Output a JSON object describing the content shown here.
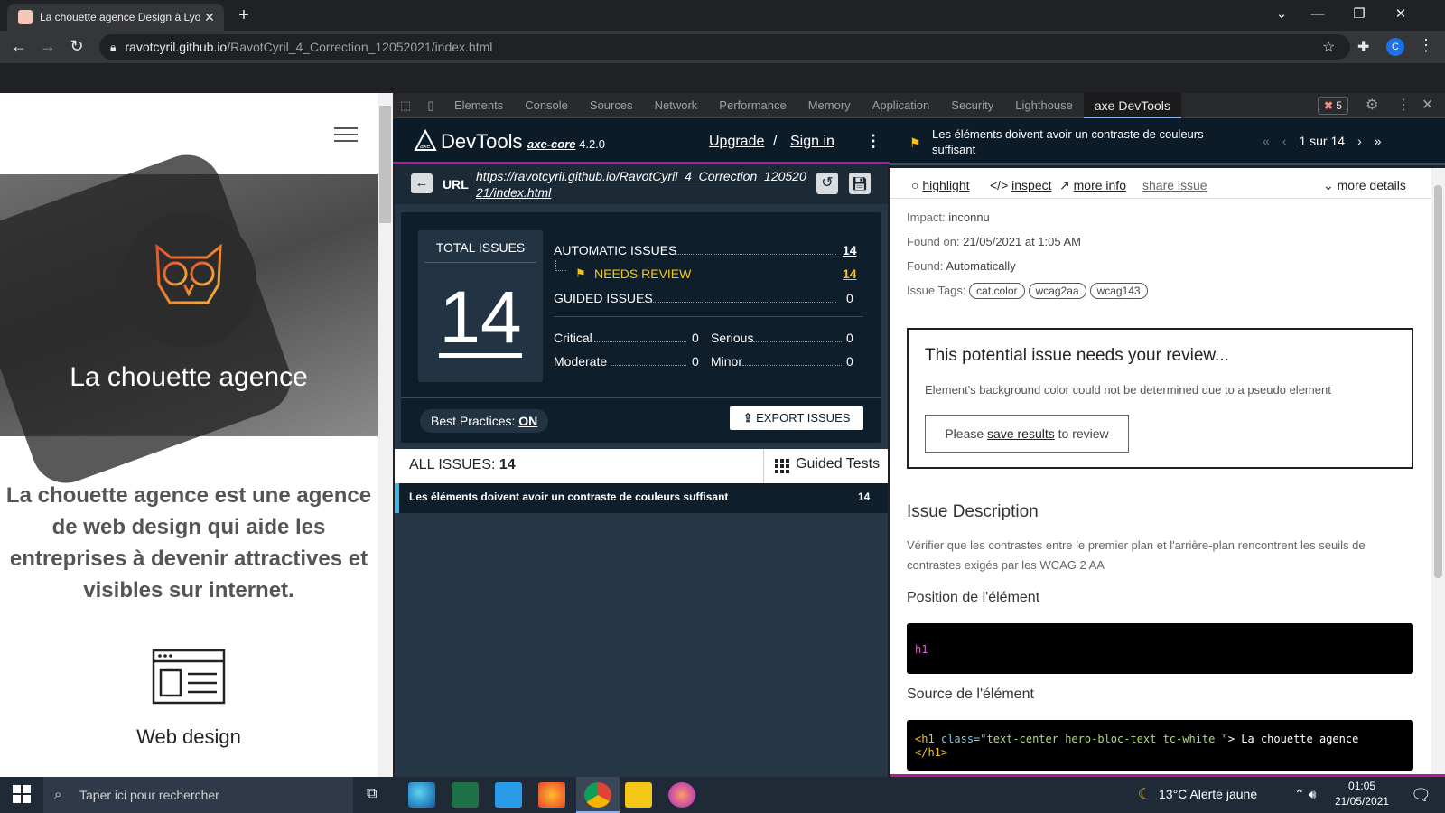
{
  "browser": {
    "tab_title": "La chouette agence Design à Lyo",
    "url_host": "ravotcyril.github.io",
    "url_path": "/RavotCyril_4_Correction_12052021/index.html",
    "profile_initial": "C"
  },
  "page": {
    "hero_title": "La chouette agence",
    "intro": "La chouette agence est une agence de web design qui aide les entreprises à devenir attractives et visibles sur internet.",
    "service_label": "Web design"
  },
  "devtools": {
    "tabs": [
      "Elements",
      "Console",
      "Sources",
      "Network",
      "Performance",
      "Memory",
      "Application",
      "Security",
      "Lighthouse",
      "axe DevTools"
    ],
    "active_tab": "axe DevTools",
    "error_count": "5"
  },
  "axe": {
    "brand": "DevTools",
    "core_label": "axe-core",
    "core_version": "4.2.0",
    "upgrade": "Upgrade",
    "slash": "/",
    "signin": "Sign in",
    "url_label": "URL",
    "url_value": "https://ravotcyril.github.io/RavotCyril_4_Correction_12052021/index.html",
    "total_label": "TOTAL ISSUES",
    "total": "14",
    "automatic_label": "AUTOMATIC ISSUES",
    "automatic": "14",
    "needs_review_label": "NEEDS REVIEW",
    "needs_review": "14",
    "guided_label": "GUIDED ISSUES",
    "guided": "0",
    "critical_label": "Critical",
    "critical": "0",
    "serious_label": "Serious",
    "serious": "0",
    "moderate_label": "Moderate",
    "moderate": "0",
    "minor_label": "Minor",
    "minor": "0",
    "best_practices_label": "Best Practices:",
    "best_practices": "ON",
    "export": "EXPORT ISSUES",
    "all_issues_label": "ALL ISSUES:",
    "all_issues": "14",
    "guided_tests": "Guided Tests",
    "issues": [
      {
        "title": "Les éléments doivent avoir un contraste de couleurs suffisant",
        "count": "14"
      }
    ]
  },
  "detail": {
    "title": "Les éléments doivent avoir un contraste de couleurs suffisant",
    "pager": "1 sur 14",
    "actions": {
      "highlight": "highlight",
      "inspect": "inspect",
      "more_info": "more info",
      "share": "share issue",
      "more_details": "more details"
    },
    "impact_label": "Impact:",
    "impact": "inconnu",
    "found_on_label": "Found on:",
    "found_on": "21/05/2021 at 1:05 AM",
    "found_label": "Found:",
    "found": "Automatically",
    "tags_label": "Issue Tags:",
    "tags": [
      "cat.color",
      "wcag2aa",
      "wcag143"
    ],
    "review_title": "This potential issue needs your review...",
    "review_text": "Element's background color could not be determined due to a pseudo element",
    "review_btn_prefix": "Please",
    "review_btn_link": "save results",
    "review_btn_suffix": "to review",
    "desc_title": "Issue Description",
    "desc_text": "Vérifier que les contrastes entre le premier plan et l'arrière-plan rencontrent les seuils de contrastes exigés par les WCAG 2 AA",
    "position_title": "Position de l'élément",
    "position_code": "h1",
    "source_title": "Source de l'élément",
    "source_tag_open": "<h1",
    "source_attr": "class=",
    "source_val": "\"text-center hero-bloc-text tc-white \"",
    "source_text": "> La chouette agence",
    "source_tag_close": "</h1>"
  },
  "taskbar": {
    "search_placeholder": "Taper ici pour rechercher",
    "weather": "13°C  Alerte jaune",
    "time": "01:05",
    "date": "21/05/2021"
  },
  "colors": {
    "axe_navy": "#0b1b28",
    "axe_panel": "#253746",
    "needs_review": "#f5c518",
    "accent_magenta": "#b5179e"
  }
}
